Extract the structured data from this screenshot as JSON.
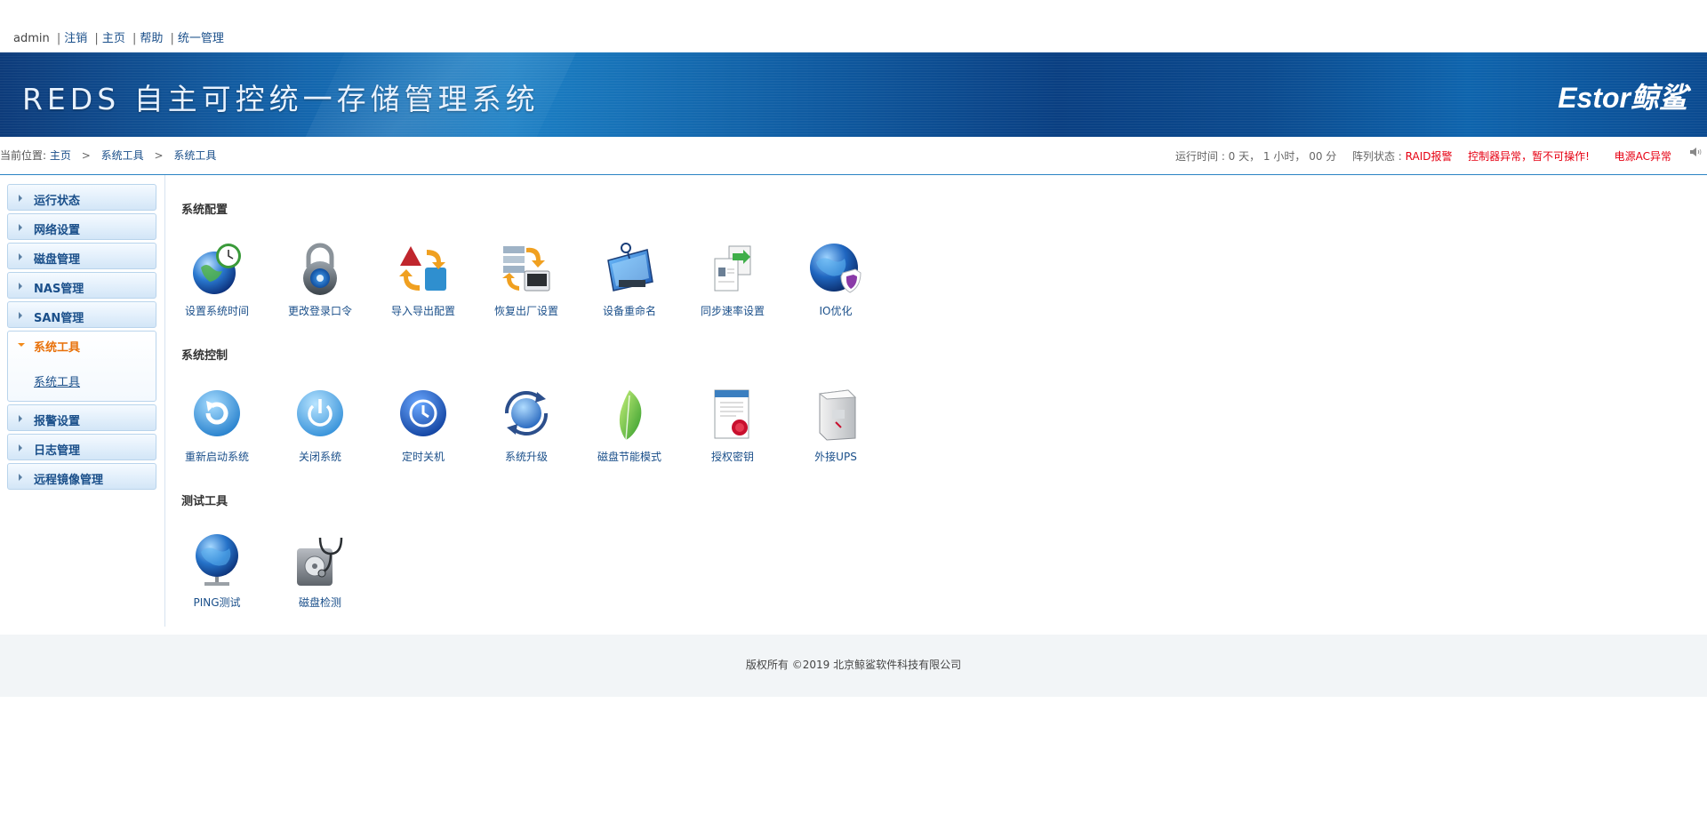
{
  "topnav": {
    "user": "admin",
    "logout": "注销",
    "home": "主页",
    "help": "帮助",
    "unified": "统一管理",
    "separator": "|"
  },
  "banner": {
    "title": "REDS 自主可控统一存储管理系统",
    "brand": "Estor鲸鲨"
  },
  "breadcrumb": {
    "prefix": "当前位置:",
    "home": "主页",
    "level1": "系统工具",
    "level2": "系统工具",
    "arrow": ">"
  },
  "status": {
    "runtime": "运行时间 : 0 天， 1 小时， 00 分",
    "array_label": "阵列状态 :",
    "raid_alarm": "RAID报警",
    "controller_error": "控制器异常，暂不可操作!",
    "power_error": "电源AC异常",
    "colors": {
      "alert": "#e60012"
    }
  },
  "sidebar": {
    "items": [
      {
        "label": "运行状态"
      },
      {
        "label": "网络设置"
      },
      {
        "label": "磁盘管理"
      },
      {
        "label": "NAS管理"
      },
      {
        "label": "SAN管理"
      },
      {
        "label": "系统工具",
        "sub": "系统工具"
      },
      {
        "label": "报警设置"
      },
      {
        "label": "日志管理"
      },
      {
        "label": "远程镜像管理"
      }
    ]
  },
  "sections": [
    {
      "title": "系统配置",
      "tools": [
        {
          "label": "设置系统时间",
          "icon": "globe-clock-icon"
        },
        {
          "label": "更改登录口令",
          "icon": "padlock-icon"
        },
        {
          "label": "导入导出配置",
          "icon": "import-export-icon"
        },
        {
          "label": "恢复出厂设置",
          "icon": "restore-factory-icon"
        },
        {
          "label": "设备重命名",
          "icon": "device-rename-icon"
        },
        {
          "label": "同步速率设置",
          "icon": "sync-rate-icon"
        },
        {
          "label": "IO优化",
          "icon": "globe-shield-icon"
        }
      ]
    },
    {
      "title": "系统控制",
      "tools": [
        {
          "label": "重新启动系统",
          "icon": "restart-icon"
        },
        {
          "label": "关闭系统",
          "icon": "power-icon"
        },
        {
          "label": "定时关机",
          "icon": "timer-icon"
        },
        {
          "label": "系统升级",
          "icon": "upgrade-globe-icon"
        },
        {
          "label": "磁盘节能模式",
          "icon": "leaf-icon"
        },
        {
          "label": "授权密钥",
          "icon": "certificate-icon"
        },
        {
          "label": "外接UPS",
          "icon": "ups-icon"
        }
      ]
    },
    {
      "title": "测试工具",
      "tools": [
        {
          "label": "PING测试",
          "icon": "network-globe-icon"
        },
        {
          "label": "磁盘检测",
          "icon": "disk-stethoscope-icon"
        }
      ]
    }
  ],
  "footer": {
    "text": "版权所有 ©2019 北京鲸鲨软件科技有限公司"
  }
}
